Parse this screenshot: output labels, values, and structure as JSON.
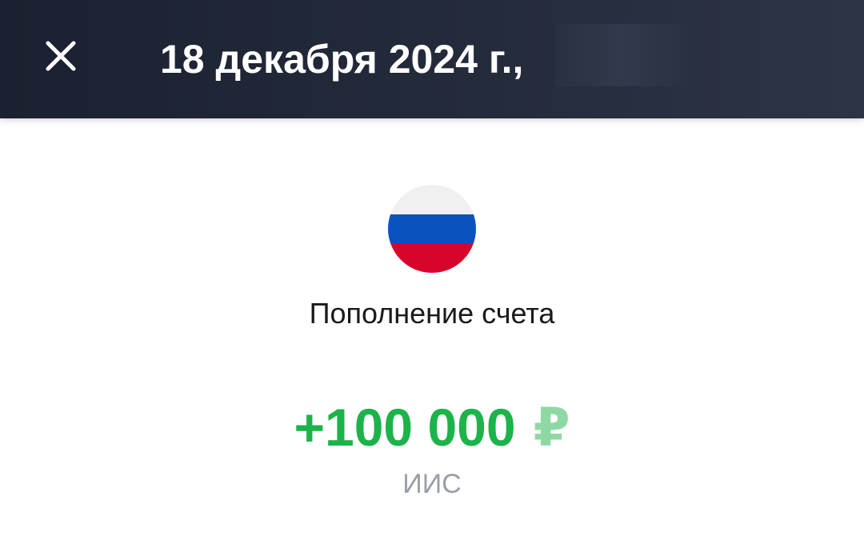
{
  "header": {
    "close_icon": "close-icon",
    "date_title": "18 декабря 2024 г.,"
  },
  "operation": {
    "flag_icon": "russia-flag-icon",
    "title": "Пополнение счета",
    "amount": "+100 000",
    "currency": "₽",
    "account": "ИИС"
  },
  "colors": {
    "header_bg": "#1f2535",
    "amount_green": "#1cb34a",
    "currency_green": "#8ed8a3",
    "label_gray": "#9a9ea6"
  }
}
